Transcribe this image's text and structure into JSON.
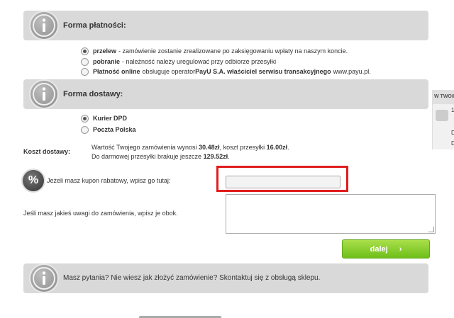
{
  "payment": {
    "title": "Forma płatności:",
    "options": [
      {
        "name": "przelew",
        "desc": " - zamówienie zostanie zrealizowane po zaksięgowaniu wpłaty na naszym koncie.",
        "checked": true
      },
      {
        "name": "pobranie",
        "desc": " - należność należy uregulować przy odbiorze przesyłki",
        "checked": false
      },
      {
        "name": "Płatność online",
        "desc": " obsługuje operator ",
        "desc_bold": "PayU S.A. właściciel serwisu transakcyjnego",
        "desc_tail": " www.payu.pl.",
        "checked": false
      }
    ]
  },
  "delivery": {
    "title": "Forma dostawy:",
    "options": [
      {
        "name": "Kurier DPD",
        "checked": true
      },
      {
        "name": "Poczta Polska",
        "checked": false
      }
    ]
  },
  "cost": {
    "label": "Koszt dostawy:",
    "line1_a": "Wartość Twojego zamówienia wynosi ",
    "line1_b": "30.48zł",
    "line1_c": ", koszt przesyłki ",
    "line1_d": "16.00zł",
    "line1_e": ".",
    "line2_a": "Do darmowej przesyłki brakuje jeszcze ",
    "line2_b": "129.52zł",
    "line2_c": "."
  },
  "coupon": {
    "icon": "%",
    "label": "Jeżeli masz kupon rabatowy, wpisz go tutaj:",
    "value": ""
  },
  "comments": {
    "label": "Jeśli masz jakieś uwagi do zamówienia, wpisz je obok.",
    "value": ""
  },
  "next_button": {
    "label": "dalej",
    "icon": "›"
  },
  "help": {
    "text": "Masz pytania? Nie wiesz jak złożyć zamówienie? Skontaktuj się z obsługą sklepu."
  },
  "side_panel": {
    "header": "W TWOIM",
    "rows": [
      "1",
      "D",
      "D"
    ]
  },
  "colors": {
    "accent_green": "#7cc520",
    "highlight_red": "#e01d1d",
    "bar_gray": "#d9d9d9"
  }
}
